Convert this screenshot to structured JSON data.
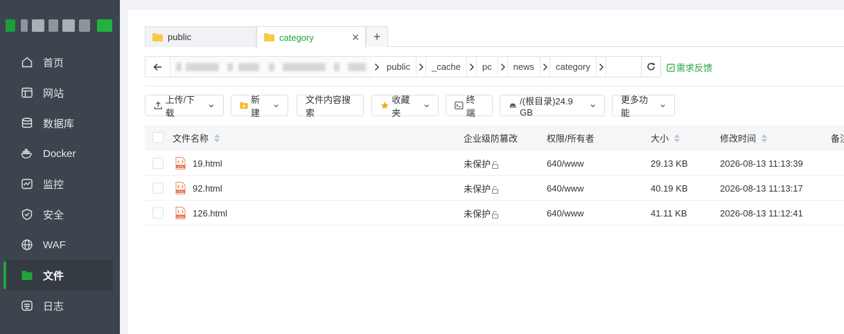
{
  "sidebar": {
    "items": [
      {
        "label": "首页",
        "icon": "home-icon"
      },
      {
        "label": "网站",
        "icon": "website-icon"
      },
      {
        "label": "数据库",
        "icon": "database-icon"
      },
      {
        "label": "Docker",
        "icon": "docker-icon"
      },
      {
        "label": "监控",
        "icon": "monitor-icon"
      },
      {
        "label": "安全",
        "icon": "shield-icon"
      },
      {
        "label": "WAF",
        "icon": "waf-icon"
      },
      {
        "label": "文件",
        "icon": "folder-icon",
        "active": true
      },
      {
        "label": "日志",
        "icon": "log-icon"
      }
    ],
    "accent": "#20a53a"
  },
  "tabs": [
    {
      "label": "public"
    },
    {
      "label": "category",
      "active": true
    },
    {
      "label": "+"
    }
  ],
  "path": {
    "segments": [
      "public",
      "_cache",
      "pc",
      "news",
      "category"
    ]
  },
  "feedback_label": "需求反馈",
  "toolbar": {
    "upload": "上传/下载",
    "create": "新建",
    "search_content": "文件内容搜索",
    "favorites": "收藏夹",
    "terminal": "终端",
    "disk": "/(根目录)24.9 GB",
    "more": "更多功能"
  },
  "table": {
    "headers": {
      "name": "文件名称",
      "tamper": "企业级防篡改",
      "perm": "权限/所有者",
      "size": "大小",
      "mtime": "修改时间",
      "note": "备注"
    },
    "rows": [
      {
        "name": "19.html",
        "tamper": "未保护",
        "perm": "640/www",
        "size": "29.13 KB",
        "mtime": "2026-08-13 11:13:39"
      },
      {
        "name": "92.html",
        "tamper": "未保护",
        "perm": "640/www",
        "size": "40.19 KB",
        "mtime": "2026-08-13 11:13:17"
      },
      {
        "name": "126.html",
        "tamper": "未保护",
        "perm": "640/www",
        "size": "41.11 KB",
        "mtime": "2026-08-13 11:12:41"
      }
    ]
  }
}
